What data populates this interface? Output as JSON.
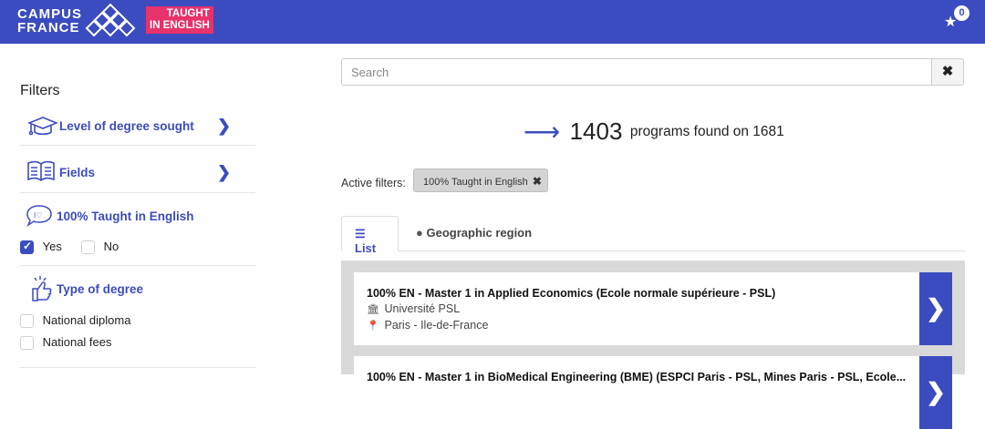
{
  "header": {
    "logo_line1": "CAMPUS",
    "logo_line2": "FRANCE",
    "badge_line1": "TAUGHT",
    "badge_line2": "IN ENGLISH",
    "favorites_count": "0",
    "brand_color": "#3b4cc0",
    "badge_color": "#e7326b"
  },
  "sidebar": {
    "title": "Filters",
    "filters": [
      {
        "label": "Level of degree sought",
        "icon": "graduation-cap-icon"
      },
      {
        "label": "Fields",
        "icon": "open-book-icon"
      },
      {
        "label": "100% Taught in English",
        "icon": "speech-bubble-icon"
      },
      {
        "label": "Type of degree",
        "icon": "thumbs-up-icon"
      }
    ],
    "english_options": {
      "yes": "Yes",
      "no": "No",
      "yes_checked": true,
      "no_checked": false
    },
    "degree_options": {
      "national_diploma": "National diploma",
      "national_fees": "National fees"
    }
  },
  "search": {
    "placeholder": "Search",
    "clear_icon": "close-icon"
  },
  "results": {
    "count": "1403",
    "text": "programs found on 1681"
  },
  "active_filters": {
    "label": "Active filters:",
    "chip": "100% Taught in English"
  },
  "tabs": {
    "list": "List",
    "region": "Geographic region"
  },
  "programs": [
    {
      "title": "100% EN - Master 1 in Applied Economics (Ecole normale supérieure - PSL)",
      "university": "Université PSL",
      "location": "Paris - Ile-de-France"
    },
    {
      "title": "100% EN - Master 1 in BioMedical Engineering (BME) (ESPCI Paris - PSL, Mines Paris - PSL, Ecole...",
      "university": "",
      "location": ""
    }
  ]
}
